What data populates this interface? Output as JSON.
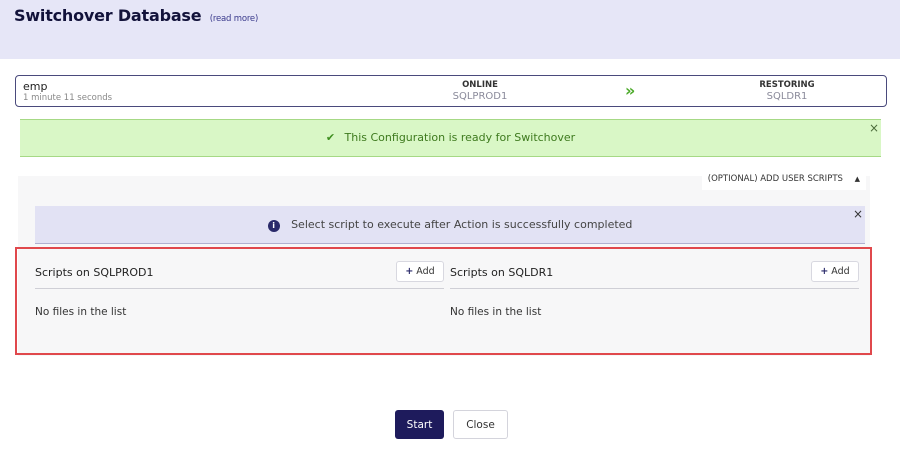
{
  "header": {
    "title": "Switchover Database",
    "read_more": "(read more)"
  },
  "database": {
    "name": "emp",
    "elapsed": "1 minute 11 seconds",
    "primary": {
      "state": "ONLINE",
      "server": "SQLPROD1"
    },
    "secondary": {
      "state": "RESTORING",
      "server": "SQLDR1"
    },
    "sync_icon": "double-chevron-right-icon"
  },
  "ready_banner": {
    "message": "This Configuration is ready for Switchover",
    "close": "×",
    "color": "#d9f7c6"
  },
  "optional_scripts": {
    "label": "(OPTIONAL) ADD USER SCRIPTS",
    "caret": "▲"
  },
  "info_banner": {
    "icon": "i",
    "message": "Select script to execute after Action is successfully completed",
    "close": "×"
  },
  "scripts": [
    {
      "title": "Scripts on SQLPROD1",
      "add_label": "Add",
      "empty": "No files in the list"
    },
    {
      "title": "Scripts on SQLDR1",
      "add_label": "Add",
      "empty": "No files in the list"
    }
  ],
  "actions": {
    "start": "Start",
    "close": "Close",
    "primary_color": "#1e1b5c"
  }
}
